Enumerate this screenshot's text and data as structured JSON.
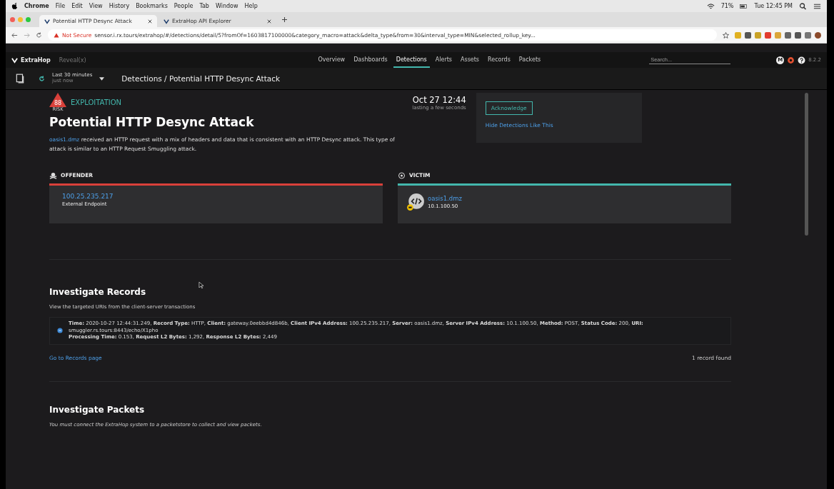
{
  "mac_menu": {
    "app": "Chrome",
    "items": [
      "File",
      "Edit",
      "View",
      "History",
      "Bookmarks",
      "People",
      "Tab",
      "Window",
      "Help"
    ],
    "battery": "71%",
    "clock": "Tue 12:45 PM"
  },
  "browser": {
    "tabs": [
      {
        "title": "Potential HTTP Desync Attack",
        "selected": true
      },
      {
        "title": "ExtraHop API Explorer",
        "selected": false
      }
    ],
    "security": "Not Secure",
    "url": "sensor.i.rx.tours/extrahop/#/detections/detail/5?fromOf=1603817100000&category_macro=attack&delta_type&from=30&interval_type=MIN&selected_rollup_key..."
  },
  "app_nav": {
    "brand": "ExtraHop",
    "product": "Reveal(x)",
    "items": [
      {
        "label": "Overview",
        "selected": false
      },
      {
        "label": "Dashboards",
        "selected": false
      },
      {
        "label": "Detections",
        "selected": true
      },
      {
        "label": "Alerts",
        "selected": false
      },
      {
        "label": "Assets",
        "selected": false
      },
      {
        "label": "Records",
        "selected": false
      },
      {
        "label": "Packets",
        "selected": false
      }
    ],
    "search": {
      "placeholder": "Search..."
    },
    "avatar": "M",
    "version": "8.2.2"
  },
  "sub_bar": {
    "time_range": "Last 30 minutes",
    "time_note": "just now",
    "breadcrumb": "Detections / Potential HTTP Desync Attack"
  },
  "detection": {
    "risk": "88",
    "risk_label": "RISK",
    "category": "EXPLOITATION",
    "title": "Potential HTTP Desync Attack",
    "description_link": "oasis1.dmz",
    "description": "received an HTTP request with a mix of headers and data that is consistent with an HTTP Desync attack. This type of attack is similar to an HTTP Request Smuggling attack.",
    "date": "Oct 27 12:44",
    "duration": "lasting a few seconds",
    "acknowledge": "Acknowledge",
    "hide_link": "Hide Detections Like This"
  },
  "offender": {
    "heading": "OFFENDER",
    "ip": "100.25.235.217",
    "role": "External Endpoint",
    "color": "#d9403a"
  },
  "victim": {
    "heading": "VICTIM",
    "name": "oasis1.dmz",
    "ip": "10.1.100.50",
    "color": "#43b7ad"
  },
  "records": {
    "title": "Investigate Records",
    "subtitle": "View the targeted URIs from the client-server transactions",
    "lines": [
      "**Time:** 2020-10-27 12:44:31.249, **Record Type:** HTTP, **Client:** gateway.0eebbd4d846b, **Client IPv4 Address:** 100.25.235.217, **Server:** oasis1.dmz, **Server IPv4 Address:** 10.1.100.50, **Method:** POST, **Status Code:** 200, **URI:** smuggler.rs.tours:8443/echo/X1pho",
      "**Processing Time:** 0.153, **Request L2 Bytes:** 1,292, **Response L2 Bytes:** 2,449"
    ],
    "link": "Go to Records page",
    "count": "1 record found"
  },
  "packets": {
    "title": "Investigate Packets",
    "text": "You must connect the ExtraHop system to a packetstore to collect and view packets."
  }
}
